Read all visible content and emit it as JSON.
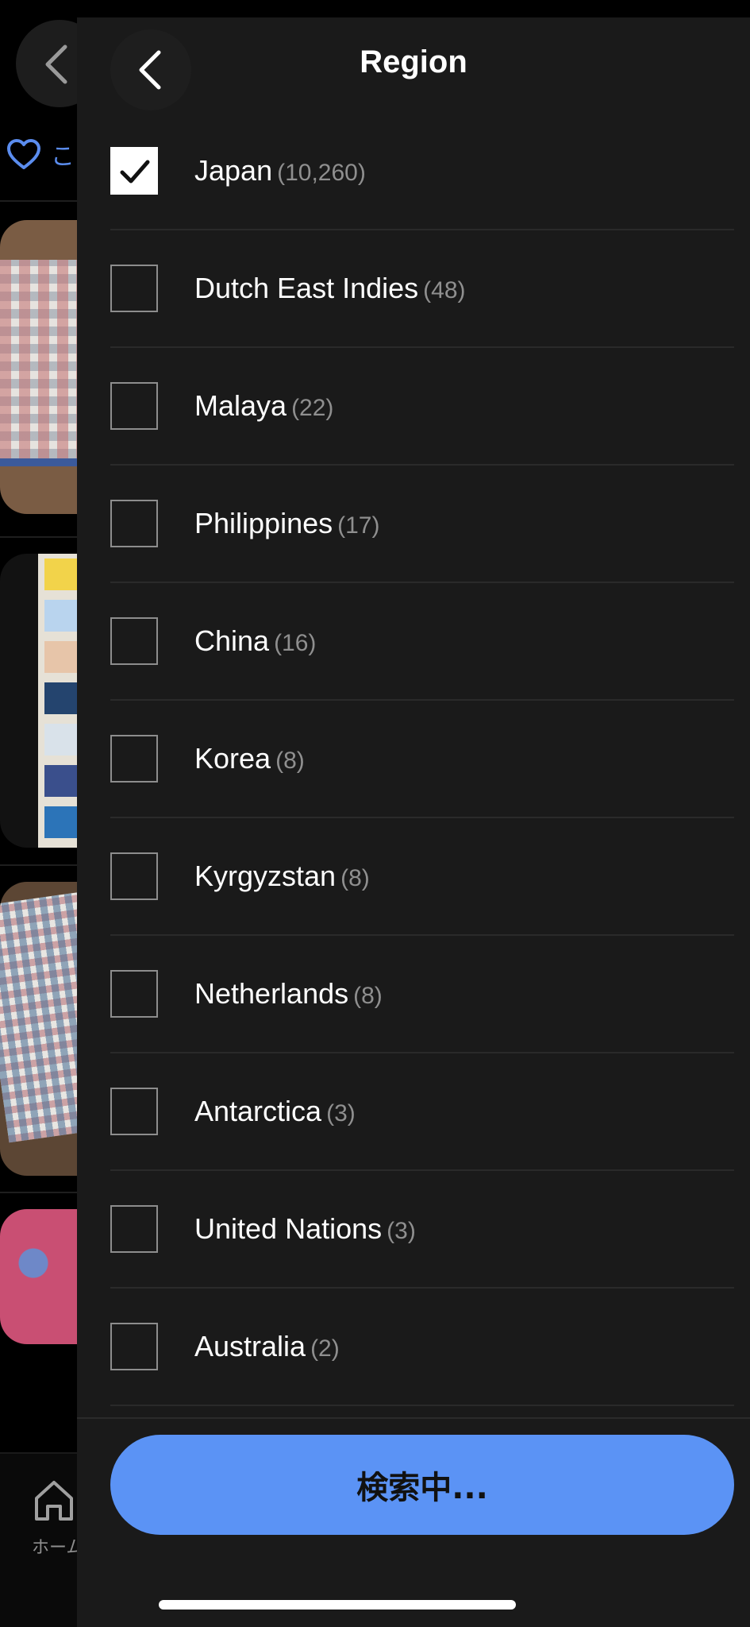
{
  "header": {
    "title": "Region"
  },
  "regions": [
    {
      "name": "Japan",
      "count": "(10,260)",
      "checked": true
    },
    {
      "name": "Dutch East Indies",
      "count": "(48)",
      "checked": false
    },
    {
      "name": "Malaya",
      "count": "(22)",
      "checked": false
    },
    {
      "name": "Philippines",
      "count": "(17)",
      "checked": false
    },
    {
      "name": "China",
      "count": "(16)",
      "checked": false
    },
    {
      "name": "Korea",
      "count": "(8)",
      "checked": false
    },
    {
      "name": "Kyrgyzstan",
      "count": "(8)",
      "checked": false
    },
    {
      "name": "Netherlands",
      "count": "(8)",
      "checked": false
    },
    {
      "name": "Antarctica",
      "count": "(3)",
      "checked": false
    },
    {
      "name": "United Nations",
      "count": "(3)",
      "checked": false
    },
    {
      "name": "Australia",
      "count": "(2)",
      "checked": false
    }
  ],
  "footer": {
    "search_label": "検索中..."
  },
  "background_page": {
    "favorite_label": "こ",
    "tab_home_label": "ホーム"
  },
  "colors": {
    "accent": "#5b93f5",
    "sheet_bg": "#1a1a1a",
    "favorite_blue": "#5b8def"
  }
}
